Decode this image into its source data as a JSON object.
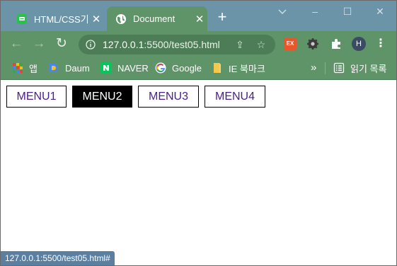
{
  "browser": {
    "tabs": [
      {
        "title": "HTML/CSS기초",
        "close": "✕",
        "active": false
      },
      {
        "title": "Document",
        "close": "✕",
        "active": true
      }
    ],
    "new_tab": "+",
    "window_controls": {
      "minimize": "–",
      "maximize": "☐",
      "close": "✕"
    },
    "toolbar": {
      "back": "←",
      "forward": "→",
      "reload": "↻",
      "url_host": "127.0.0.1",
      "url_rest": ":5500/test05.html",
      "share_icon": "⇪",
      "star_icon": "☆",
      "ext_label": "EX",
      "profile_initial": "H",
      "menu": "⋮"
    },
    "bookmarks": [
      {
        "label": "앱",
        "icon": "apps-grid-icon"
      },
      {
        "label": "Daum",
        "icon": "daum-icon"
      },
      {
        "label": "NAVER",
        "icon": "naver-icon"
      },
      {
        "label": "Google",
        "icon": "google-icon"
      },
      {
        "label": "IE 북마크",
        "icon": "folder-icon"
      }
    ],
    "bookmarks_more": "»",
    "reading_list": "읽기 목록"
  },
  "page": {
    "menu": [
      {
        "label": "MENU1",
        "active": false
      },
      {
        "label": "MENU2",
        "active": true
      },
      {
        "label": "MENU3",
        "active": false
      },
      {
        "label": "MENU4",
        "active": false
      }
    ],
    "status_url": "127.0.0.1:5500/test05.html#"
  },
  "colors": {
    "tabstrip": "#6c94a8",
    "toolbar": "#5f9368",
    "menu_text": "#4a1d8c",
    "menu_active_bg": "#000000",
    "status_bg": "#5a7fa0"
  }
}
